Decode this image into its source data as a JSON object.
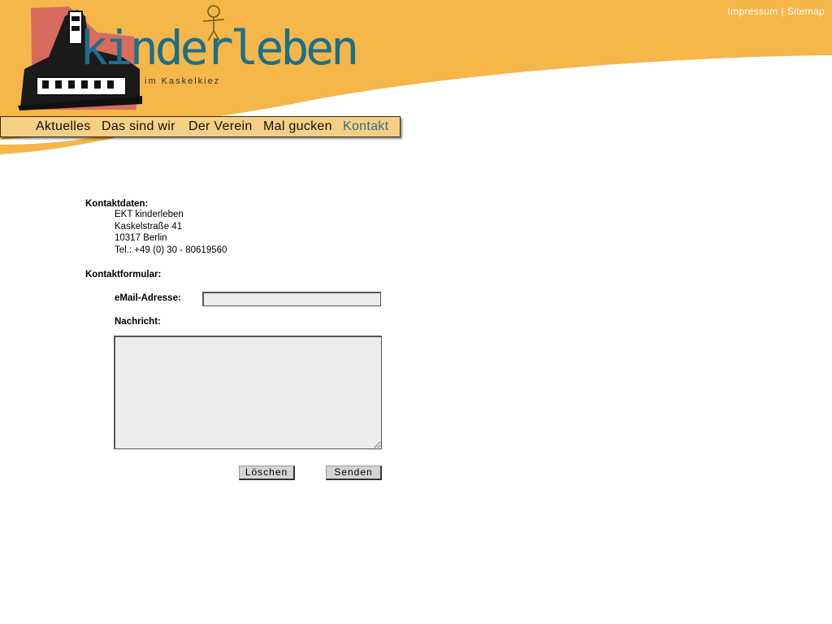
{
  "header": {
    "top_links": {
      "impressum": "Impressum",
      "separator": "|",
      "sitemap": "Sitemap"
    },
    "logo": {
      "title": "kinderleben",
      "subtitle": "im Kaskelkiez"
    }
  },
  "nav": {
    "items": [
      {
        "label": "Aktuelles"
      },
      {
        "label": "Das sind wir"
      },
      {
        "label": "Der Verein"
      },
      {
        "label": "Mal gucken"
      },
      {
        "label": "Kontakt",
        "active": true
      }
    ]
  },
  "contact": {
    "heading": "Kontaktdaten:",
    "lines": [
      "EKT kinderleben",
      "Kaskelstraße 41",
      "10317 Berlin",
      "Tel.: +49 (0) 30 - 80619560"
    ]
  },
  "form": {
    "heading": "Kontaktformular:",
    "email_label": "eMail-Adresse:",
    "email_value": "",
    "message_label": "Nachricht:",
    "message_value": "",
    "clear_button": "Löschen",
    "send_button": "Senden"
  },
  "colors": {
    "header_orange": "#f5b64a",
    "nav_bg": "#f6cf85",
    "accent_teal": "#2b6f8a"
  }
}
